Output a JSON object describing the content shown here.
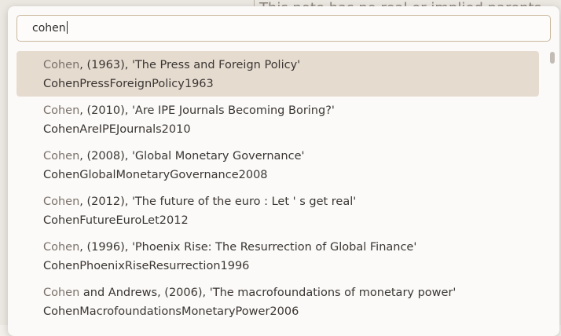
{
  "background": {
    "note_text": "This note has no real or implied parents"
  },
  "search": {
    "query": "cohen"
  },
  "results": [
    {
      "match": "Cohen",
      "rest": ", (1963), 'The Press and Foreign Policy'",
      "key": "CohenPressForeignPolicy1963",
      "selected": true
    },
    {
      "match": "Cohen",
      "rest": ", (2010), 'Are IPE Journals Becoming Boring?'",
      "key": "CohenAreIPEJournals2010"
    },
    {
      "match": "Cohen",
      "rest": ", (2008), 'Global Monetary Governance'",
      "key": "CohenGlobalMonetaryGovernance2008"
    },
    {
      "match": "Cohen",
      "rest": ", (2012), 'The future of the euro : Let ' s get real'",
      "key": "CohenFutureEuroLet2012"
    },
    {
      "match": "Cohen",
      "rest": ", (1996), 'Phoenix Rise: The Resurrection of Global Finance'",
      "key": "CohenPhoenixRiseResurrection1996"
    },
    {
      "match": "Cohen",
      "rest": " and Andrews, (2006), 'The macrofoundations of monetary power'",
      "key": "CohenMacrofoundationsMonetaryPower2006"
    }
  ],
  "colors": {
    "selected_row": "#e6dbcf",
    "input_border": "#c9b79b",
    "match_text": "#7b726a"
  }
}
